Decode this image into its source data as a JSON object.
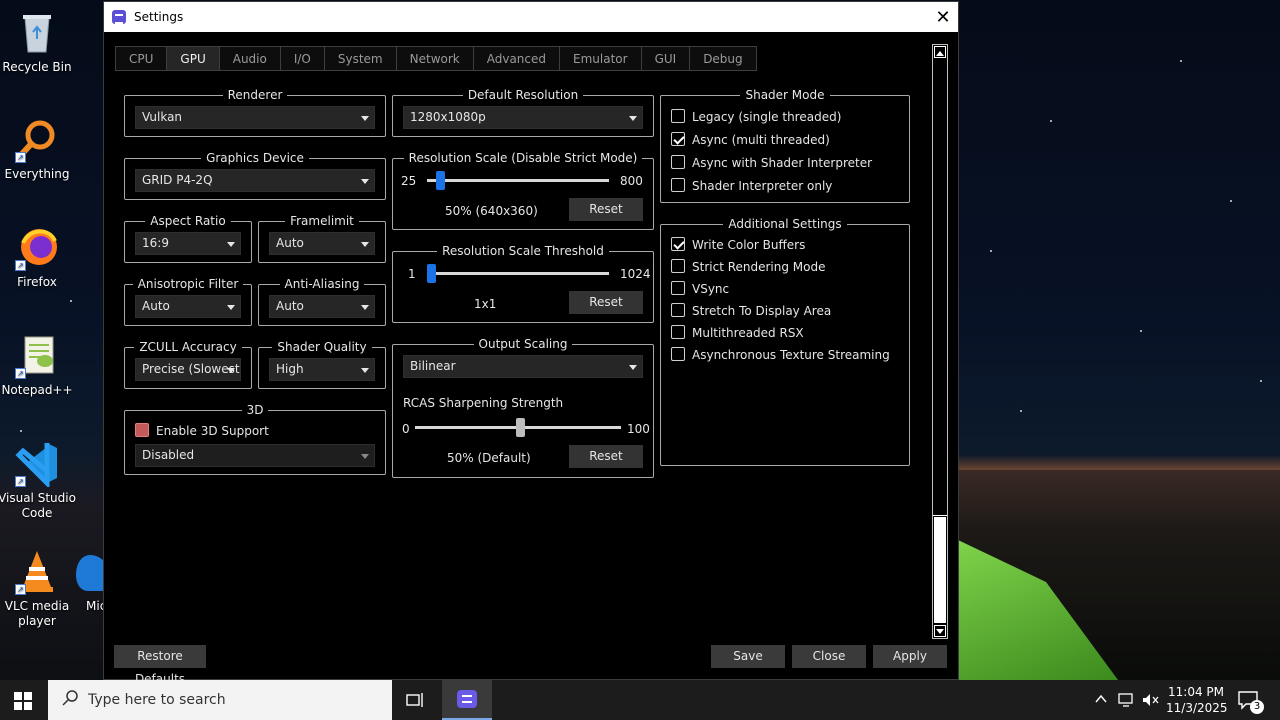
{
  "desktop": {
    "icons": [
      {
        "label": "Recycle Bin"
      },
      {
        "label": "Everything"
      },
      {
        "label": "Firefox"
      },
      {
        "label": "Notepad++"
      },
      {
        "label": "Visual Studio Code"
      },
      {
        "label": "VLC media player"
      },
      {
        "label": "Mic E"
      }
    ]
  },
  "window": {
    "title": "Settings",
    "close_glyph": "✕"
  },
  "tabs": [
    {
      "label": "CPU"
    },
    {
      "label": "GPU",
      "active": true
    },
    {
      "label": "Audio"
    },
    {
      "label": "I/O"
    },
    {
      "label": "System"
    },
    {
      "label": "Network"
    },
    {
      "label": "Advanced"
    },
    {
      "label": "Emulator"
    },
    {
      "label": "GUI"
    },
    {
      "label": "Debug"
    }
  ],
  "renderer": {
    "label": "Renderer",
    "value": "Vulkan"
  },
  "graphics_device": {
    "label": "Graphics Device",
    "value": "GRID P4-2Q"
  },
  "aspect_ratio": {
    "label": "Aspect Ratio",
    "value": "16:9"
  },
  "framelimit": {
    "label": "Framelimit",
    "value": "Auto"
  },
  "anisotropic": {
    "label": "Anisotropic Filter",
    "value": "Auto"
  },
  "antialiasing": {
    "label": "Anti-Aliasing",
    "value": "Auto"
  },
  "zcull": {
    "label": "ZCULL Accuracy",
    "value": "Precise (Slowest)"
  },
  "shader_quality": {
    "label": "Shader Quality",
    "value": "High"
  },
  "threed": {
    "label": "3D",
    "enable_label": "Enable 3D Support",
    "value": "Disabled"
  },
  "default_resolution": {
    "label": "Default Resolution",
    "value": "1280x1080p"
  },
  "res_scale": {
    "label": "Resolution Scale (Disable Strict Mode)",
    "min": "25",
    "max": "800",
    "value_text": "50% (640x360)",
    "reset": "Reset",
    "level": 0.03
  },
  "res_threshold": {
    "label": "Resolution Scale Threshold",
    "min": "1",
    "max": "1024",
    "value_text": "1x1",
    "reset": "Reset",
    "level": 0.0
  },
  "output_scaling": {
    "label": "Output Scaling",
    "value": "Bilinear",
    "rcas_label": "RCAS Sharpening Strength",
    "min": "0",
    "max": "100",
    "value_text": "50% (Default)",
    "reset": "Reset",
    "level": 0.5
  },
  "shader_mode": {
    "label": "Shader Mode",
    "options": [
      {
        "label": "Legacy (single threaded)",
        "checked": false
      },
      {
        "label": "Async (multi threaded)",
        "checked": true
      },
      {
        "label": "Async with Shader Interpreter",
        "checked": false
      },
      {
        "label": "Shader Interpreter only",
        "checked": false
      }
    ]
  },
  "additional": {
    "label": "Additional Settings",
    "options": [
      {
        "label": "Write Color Buffers",
        "checked": true
      },
      {
        "label": "Strict Rendering Mode",
        "checked": false
      },
      {
        "label": "VSync",
        "checked": false
      },
      {
        "label": "Stretch To Display Area",
        "checked": false
      },
      {
        "label": "Multithreaded RSX",
        "checked": false
      },
      {
        "label": "Asynchronous Texture Streaming",
        "checked": false
      }
    ]
  },
  "footer": {
    "restore": "Restore Defaults",
    "save": "Save",
    "close": "Close",
    "apply": "Apply"
  },
  "taskbar": {
    "search_placeholder": "Type here to search",
    "time": "11:04 PM",
    "date": "11/3/2025",
    "notif_count": "3"
  },
  "colors": {
    "accent_thumb": "#1a74e8",
    "enable3d_box": "#c25a5a",
    "tent": "#6bc33a"
  }
}
